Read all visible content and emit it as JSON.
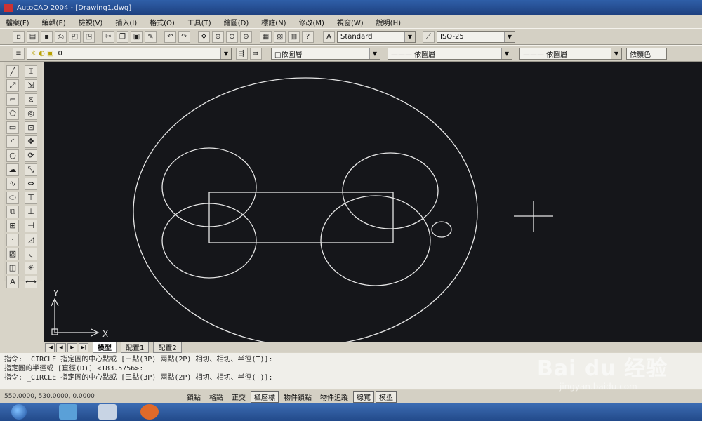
{
  "title": "AutoCAD 2004 - [Drawing1.dwg]",
  "menu": [
    "檔案(F)",
    "編輯(E)",
    "檢視(V)",
    "插入(I)",
    "格式(O)",
    "工具(T)",
    "繪圖(D)",
    "標註(N)",
    "修改(M)",
    "視窗(W)",
    "說明(H)"
  ],
  "toolbar": {
    "text_style": "Standard",
    "dim_style": "ISO-25",
    "layer": "0",
    "color": "□依圖層",
    "linetype": "——— 依圖層",
    "lineweight": "——— 依圖層",
    "plot_style": "依顏色"
  },
  "canvas": {
    "ucs_x": "X",
    "ucs_y": "Y"
  },
  "tabs": [
    "模型",
    "配置1",
    "配置2"
  ],
  "command_lines": [
    "指令:  _CIRCLE 指定圓的中心點或 [三點(3P) 兩點(2P) 相切、相切、半徑(T)]:",
    "指定圓的半徑或 [直徑(D)] <183.5756>:",
    "指令:  _CIRCLE 指定圓的中心點或 [三點(3P) 兩點(2P) 相切、相切、半徑(T)]:"
  ],
  "status": {
    "coords": "550.0000, 530.0000, 0.0000",
    "buttons": [
      "鎖點",
      "格點",
      "正交",
      "極座標",
      "物件鎖點",
      "物件追蹤",
      "線寬",
      "模型"
    ],
    "on": [
      false,
      false,
      false,
      true,
      false,
      false,
      true,
      true
    ]
  },
  "watermark": {
    "brand": "Bai du 经验",
    "url": "jingyan.baidu.com"
  },
  "colors": {
    "canvas_bg": "#15161a",
    "geometry": "#e6e6e6"
  }
}
